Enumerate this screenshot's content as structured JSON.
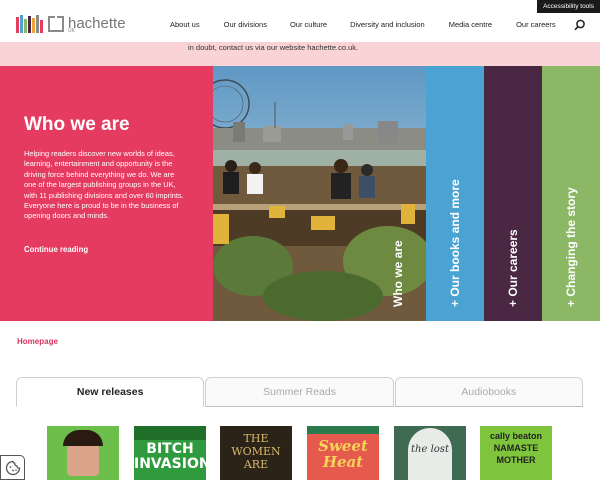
{
  "header": {
    "logo_text": "hachette",
    "logo_sub": "UK",
    "accessibility_label": "Accessibility tools",
    "nav": [
      {
        "label": "About us"
      },
      {
        "label": "Our divisions"
      },
      {
        "label": "Our culture"
      },
      {
        "label": "Diversity and inclusion"
      },
      {
        "label": "Media centre"
      },
      {
        "label": "Our careers"
      }
    ]
  },
  "alert": {
    "text": "in doubt, contact us via our website hachette.co.uk."
  },
  "hero": {
    "title": "Who we are",
    "body": "Helping readers discover new worlds of ideas, learning, entertainment and opportunity is the driving force behind everything we do. We are one of the largest publishing groups in the UK, with 11 publishing divisions and over 60 imprints. Everyone here is proud to be in the business of opening doors and minds.",
    "link": "Continue reading",
    "photo_label": "Who we are",
    "panels": [
      {
        "label": "+ Our books and more",
        "color": "#4ba3d3"
      },
      {
        "label": "+ Our careers",
        "color": "#4a2743"
      },
      {
        "label": "+ Changing the story",
        "color": "#8cb865"
      }
    ]
  },
  "breadcrumb": "Homepage",
  "tabs": [
    {
      "label": "New releases",
      "active": true
    },
    {
      "label": "Summer Reads",
      "active": false
    },
    {
      "label": "Audiobooks",
      "active": false
    }
  ],
  "books": [
    {
      "cover_text": "",
      "color": "#6cbf4a"
    },
    {
      "cover_text": "BITCH INVASION",
      "color": "#2f9a3e"
    },
    {
      "cover_text": "THE WOMEN ARE",
      "color": "#2b2218"
    },
    {
      "cover_text": "Sweet Heat",
      "color": "#e55a4c"
    },
    {
      "cover_text": "the lost",
      "color": "#3e6b52"
    },
    {
      "cover_text": "cally beaton NAMASTE MOTHER",
      "color": "#7ec43c"
    }
  ],
  "colors": {
    "brand_pink": "#e63b60",
    "alert_bg": "#f9d3d6",
    "link_red": "#d6335a"
  }
}
